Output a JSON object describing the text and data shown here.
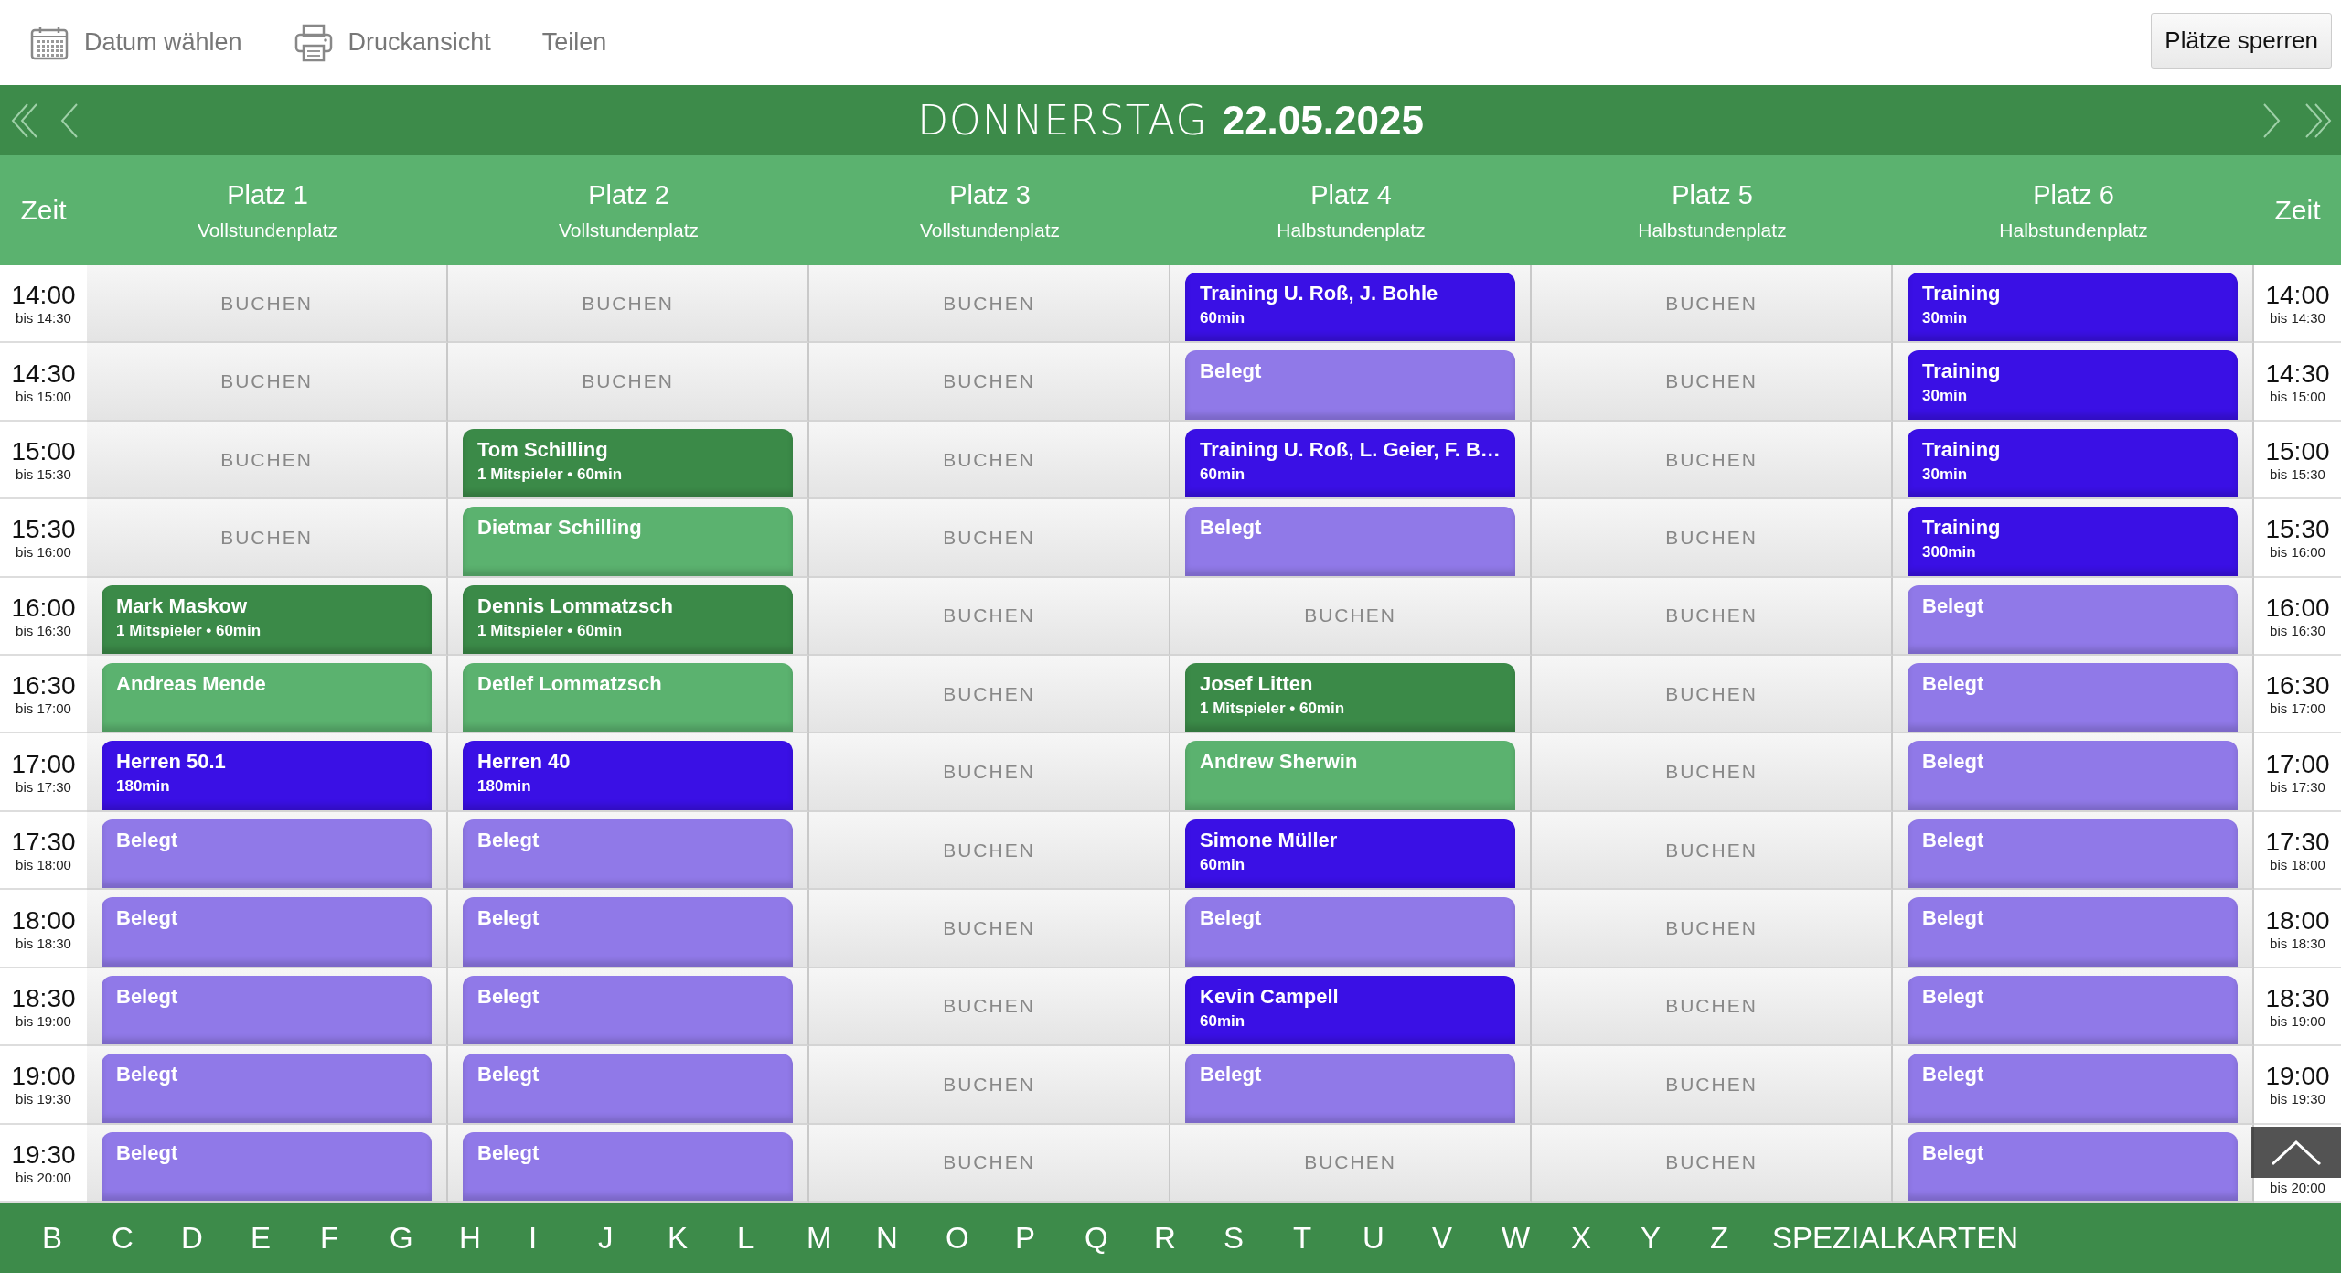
{
  "toolbar": {
    "actions": [
      {
        "kind": "calendar",
        "label": "Datum wählen"
      },
      {
        "kind": "print",
        "label": "Druckansicht"
      },
      {
        "kind": "plain",
        "label": "Teilen"
      }
    ],
    "lock_button": "Plätze sperren"
  },
  "date_bar": {
    "weekday": "DONNERSTAG",
    "date": "22.05.2025"
  },
  "time_header": "Zeit",
  "time_header_right": "Zeit",
  "courts": [
    {
      "name": "Platz 1",
      "type": "Vollstundenplatz"
    },
    {
      "name": "Platz 2",
      "type": "Vollstundenplatz"
    },
    {
      "name": "Platz 3",
      "type": "Vollstundenplatz"
    },
    {
      "name": "Platz 4",
      "type": "Halbstundenplatz"
    },
    {
      "name": "Platz 5",
      "type": "Halbstundenplatz"
    },
    {
      "name": "Platz 6",
      "type": "Halbstundenplatz"
    }
  ],
  "rows": [
    {
      "time": "14:00",
      "until": "bis 14:30",
      "right_time": "14:00",
      "right_until": "bis 14:30",
      "cells": [
        {
          "kind": "free",
          "label": "BUCHEN"
        },
        {
          "kind": "free",
          "label": "BUCHEN"
        },
        {
          "kind": "free",
          "label": "BUCHEN"
        },
        {
          "kind": "booking",
          "title": "Training U. Roß, J. Bohle",
          "detail": "60min",
          "color": "#3a10e5"
        },
        {
          "kind": "free",
          "label": "BUCHEN"
        },
        {
          "kind": "booking",
          "title": "Training",
          "detail": "30min",
          "color": "#3a10e5"
        }
      ]
    },
    {
      "time": "14:30",
      "until": "bis 15:00",
      "right_time": "14:30",
      "right_until": "bis 15:00",
      "cells": [
        {
          "kind": "free",
          "label": "BUCHEN"
        },
        {
          "kind": "free",
          "label": "BUCHEN"
        },
        {
          "kind": "free",
          "label": "BUCHEN"
        },
        {
          "kind": "booking",
          "title": "Belegt",
          "color": "#9079e8"
        },
        {
          "kind": "free",
          "label": "BUCHEN"
        },
        {
          "kind": "booking",
          "title": "Training",
          "detail": "30min",
          "color": "#3a10e5"
        }
      ]
    },
    {
      "time": "15:00",
      "until": "bis 15:30",
      "right_time": "15:00",
      "right_until": "bis 15:30",
      "cells": [
        {
          "kind": "free",
          "label": "BUCHEN"
        },
        {
          "kind": "booking",
          "title": "Tom Schilling",
          "detail": "1 Mitspieler • 60min",
          "color": "#3b8a48"
        },
        {
          "kind": "free",
          "label": "BUCHEN"
        },
        {
          "kind": "booking",
          "title": "Training U. Roß, L. Geier, F. B…",
          "detail": "60min",
          "color": "#3a10e5"
        },
        {
          "kind": "free",
          "label": "BUCHEN"
        },
        {
          "kind": "booking",
          "title": "Training",
          "detail": "30min",
          "color": "#3a10e5"
        }
      ]
    },
    {
      "time": "15:30",
      "until": "bis 16:00",
      "right_time": "15:30",
      "right_until": "bis 16:00",
      "cells": [
        {
          "kind": "free",
          "label": "BUCHEN"
        },
        {
          "kind": "booking",
          "title": "Dietmar Schilling",
          "color": "#5bb26f"
        },
        {
          "kind": "free",
          "label": "BUCHEN"
        },
        {
          "kind": "booking",
          "title": "Belegt",
          "color": "#9079e8"
        },
        {
          "kind": "free",
          "label": "BUCHEN"
        },
        {
          "kind": "booking",
          "title": "Training",
          "detail": "300min",
          "color": "#3a10e5"
        }
      ]
    },
    {
      "time": "16:00",
      "until": "bis 16:30",
      "right_time": "16:00",
      "right_until": "bis 16:30",
      "cells": [
        {
          "kind": "booking",
          "title": "Mark Maskow",
          "detail": "1 Mitspieler • 60min",
          "color": "#3b8a48"
        },
        {
          "kind": "booking",
          "title": "Dennis Lommatzsch",
          "detail": "1 Mitspieler • 60min",
          "color": "#3b8a48"
        },
        {
          "kind": "free",
          "label": "BUCHEN"
        },
        {
          "kind": "free",
          "label": "BUCHEN"
        },
        {
          "kind": "free",
          "label": "BUCHEN"
        },
        {
          "kind": "booking",
          "title": "Belegt",
          "color": "#9079e8"
        }
      ]
    },
    {
      "time": "16:30",
      "until": "bis 17:00",
      "right_time": "16:30",
      "right_until": "bis 17:00",
      "cells": [
        {
          "kind": "booking",
          "title": "Andreas Mende",
          "color": "#5bb26f"
        },
        {
          "kind": "booking",
          "title": "Detlef Lommatzsch",
          "color": "#5bb26f"
        },
        {
          "kind": "free",
          "label": "BUCHEN"
        },
        {
          "kind": "booking",
          "title": "Josef Litten",
          "detail": "1 Mitspieler • 60min",
          "color": "#3b8a48"
        },
        {
          "kind": "free",
          "label": "BUCHEN"
        },
        {
          "kind": "booking",
          "title": "Belegt",
          "color": "#9079e8"
        }
      ]
    },
    {
      "time": "17:00",
      "until": "bis 17:30",
      "right_time": "17:00",
      "right_until": "bis 17:30",
      "cells": [
        {
          "kind": "booking",
          "title": "Herren 50.1",
          "detail": "180min",
          "color": "#3a10e5"
        },
        {
          "kind": "booking",
          "title": "Herren 40",
          "detail": "180min",
          "color": "#3a10e5"
        },
        {
          "kind": "free",
          "label": "BUCHEN"
        },
        {
          "kind": "booking",
          "title": "Andrew Sherwin",
          "color": "#5bb26f"
        },
        {
          "kind": "free",
          "label": "BUCHEN"
        },
        {
          "kind": "booking",
          "title": "Belegt",
          "color": "#9079e8"
        }
      ]
    },
    {
      "time": "17:30",
      "until": "bis 18:00",
      "right_time": "17:30",
      "right_until": "bis 18:00",
      "cells": [
        {
          "kind": "booking",
          "title": "Belegt",
          "color": "#9079e8"
        },
        {
          "kind": "booking",
          "title": "Belegt",
          "color": "#9079e8"
        },
        {
          "kind": "free",
          "label": "BUCHEN"
        },
        {
          "kind": "booking",
          "title": "Simone Müller",
          "detail": "60min",
          "color": "#3a10e5"
        },
        {
          "kind": "free",
          "label": "BUCHEN"
        },
        {
          "kind": "booking",
          "title": "Belegt",
          "color": "#9079e8"
        }
      ]
    },
    {
      "time": "18:00",
      "until": "bis 18:30",
      "right_time": "18:00",
      "right_until": "bis 18:30",
      "cells": [
        {
          "kind": "booking",
          "title": "Belegt",
          "color": "#9079e8"
        },
        {
          "kind": "booking",
          "title": "Belegt",
          "color": "#9079e8"
        },
        {
          "kind": "free",
          "label": "BUCHEN"
        },
        {
          "kind": "booking",
          "title": "Belegt",
          "color": "#9079e8"
        },
        {
          "kind": "free",
          "label": "BUCHEN"
        },
        {
          "kind": "booking",
          "title": "Belegt",
          "color": "#9079e8"
        }
      ]
    },
    {
      "time": "18:30",
      "until": "bis 19:00",
      "right_time": "18:30",
      "right_until": "bis 19:00",
      "cells": [
        {
          "kind": "booking",
          "title": "Belegt",
          "color": "#9079e8"
        },
        {
          "kind": "booking",
          "title": "Belegt",
          "color": "#9079e8"
        },
        {
          "kind": "free",
          "label": "BUCHEN"
        },
        {
          "kind": "booking",
          "title": "Kevin Campell",
          "detail": "60min",
          "color": "#3a10e5"
        },
        {
          "kind": "free",
          "label": "BUCHEN"
        },
        {
          "kind": "booking",
          "title": "Belegt",
          "color": "#9079e8"
        }
      ]
    },
    {
      "time": "19:00",
      "until": "bis 19:30",
      "right_time": "19:00",
      "right_until": "bis 19:30",
      "cells": [
        {
          "kind": "booking",
          "title": "Belegt",
          "color": "#9079e8"
        },
        {
          "kind": "booking",
          "title": "Belegt",
          "color": "#9079e8"
        },
        {
          "kind": "free",
          "label": "BUCHEN"
        },
        {
          "kind": "booking",
          "title": "Belegt",
          "color": "#9079e8"
        },
        {
          "kind": "free",
          "label": "BUCHEN"
        },
        {
          "kind": "booking",
          "title": "Belegt",
          "color": "#9079e8"
        }
      ]
    },
    {
      "time": "19:30",
      "until": "bis 20:00",
      "right_until": "bis 20:00",
      "cells": [
        {
          "kind": "booking",
          "title": "Belegt",
          "color": "#9079e8"
        },
        {
          "kind": "booking",
          "title": "Belegt",
          "color": "#9079e8"
        },
        {
          "kind": "free",
          "label": "BUCHEN"
        },
        {
          "kind": "free",
          "label": "BUCHEN"
        },
        {
          "kind": "free",
          "label": "BUCHEN"
        },
        {
          "kind": "booking",
          "title": "Belegt",
          "color": "#9079e8"
        }
      ]
    }
  ],
  "letters": [
    "B",
    "C",
    "D",
    "E",
    "F",
    "G",
    "H",
    "I",
    "J",
    "K",
    "L",
    "M",
    "N",
    "O",
    "P",
    "Q",
    "R",
    "S",
    "T",
    "U",
    "V",
    "W",
    "X",
    "Y",
    "Z",
    "SPEZIALKARTEN"
  ]
}
